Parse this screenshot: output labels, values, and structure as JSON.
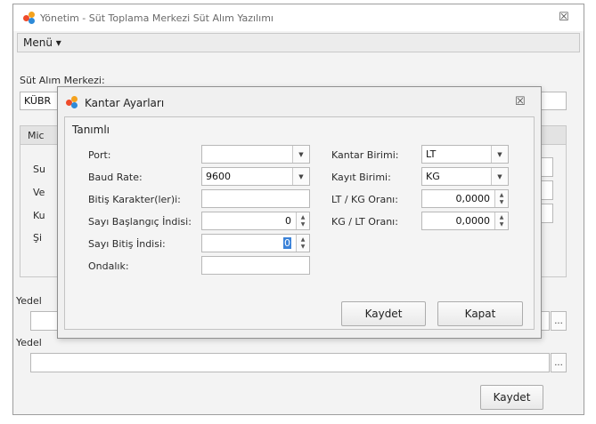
{
  "main": {
    "title": "Yönetim - Süt Toplama Merkezi Süt Alım Yazılımı",
    "close_glyph": "☒",
    "menu_label": "Menü ▾",
    "sut_alim_merkezi_label": "Süt Alım Merkezi:",
    "sut_alim_merkezi_value": "KÜBR",
    "group_header": "Mic",
    "hidden_labels": [
      "Su",
      "Ve",
      "Ku",
      "Şi"
    ],
    "yedek1_label": "Yedel",
    "yedek2_label": "Yedel",
    "ellipsis": "...",
    "save_label": "Kaydet"
  },
  "dialog": {
    "title": "Kantar Ayarları",
    "close_glyph": "☒",
    "group_title": "Tanımlı",
    "fields_left": [
      {
        "label": "Port:",
        "value": ""
      },
      {
        "label": "Baud Rate:",
        "value": "9600"
      },
      {
        "label": "Bitiş Karakter(ler)i:",
        "value": ""
      },
      {
        "label": "Sayı Başlangıç İndisi:",
        "value": "0"
      },
      {
        "label": "Sayı Bitiş İndisi:",
        "value": "0"
      },
      {
        "label": "Ondalık:",
        "value": ""
      }
    ],
    "fields_right": [
      {
        "label": "Kantar Birimi:",
        "value": "LT"
      },
      {
        "label": "Kayıt Birimi:",
        "value": "KG"
      },
      {
        "label": "LT / KG Oranı:",
        "value": "0,0000"
      },
      {
        "label": "KG / LT Oranı:",
        "value": "0,0000"
      }
    ],
    "save_label": "Kaydet",
    "close_label": "Kapat"
  },
  "icons": {
    "dropdown": "▼",
    "spin_up": "▲",
    "spin_down": "▼"
  }
}
